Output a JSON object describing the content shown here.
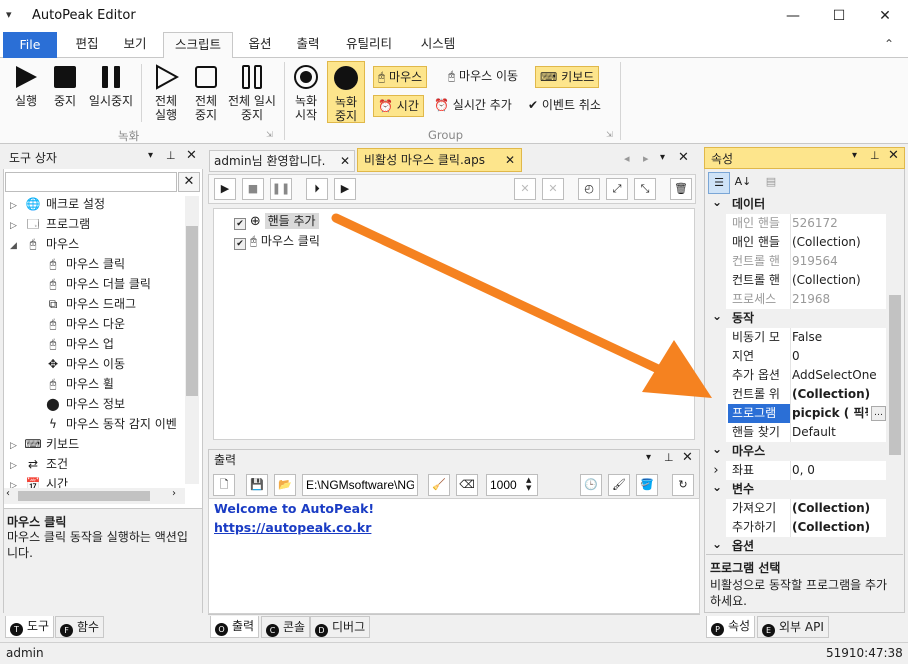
{
  "app": {
    "title": "AutoPeak Editor"
  },
  "window_controls": {
    "minimize": "—",
    "maximize": "☐",
    "close": "✕"
  },
  "ribbon_tabs": [
    "File",
    "편집",
    "보기",
    "스크립트",
    "옵션",
    "출력",
    "유틸리티",
    "시스템"
  ],
  "ribbon_active_tab": "스크립트",
  "ribbon": {
    "group1": {
      "label": "녹화",
      "buttons": [
        "실행",
        "중지",
        "일시중지",
        "전체 실행",
        "전체 중지",
        "전체 일시중지"
      ]
    },
    "group2": {
      "label": "Group",
      "record_start": "녹화 시작",
      "record_stop": "녹화 중지",
      "mouse": "마우스",
      "mouse_move": "마우스 이동",
      "keyboard": "키보드",
      "time": "시간",
      "realtime_add": "실시간 추가",
      "event_cancel": "이벤트 취소"
    }
  },
  "toolbox": {
    "title": "도구 상자",
    "search_placeholder": "",
    "items": [
      {
        "label": "매크로 설정",
        "level": 0,
        "expander": "▷",
        "icon": "globe-icon"
      },
      {
        "label": "프로그램",
        "level": 0,
        "expander": "▷",
        "icon": "window-icon"
      },
      {
        "label": "마우스",
        "level": 0,
        "expander": "◢",
        "icon": "mouse-icon"
      },
      {
        "label": "마우스 클릭",
        "level": 1,
        "icon": "mouse-click-icon"
      },
      {
        "label": "마우스 더블 클릭",
        "level": 1,
        "icon": "mouse-double-click-icon"
      },
      {
        "label": "마우스 드래그",
        "level": 1,
        "icon": "mouse-drag-icon"
      },
      {
        "label": "마우스 다운",
        "level": 1,
        "icon": "mouse-down-icon"
      },
      {
        "label": "마우스 업",
        "level": 1,
        "icon": "mouse-up-icon"
      },
      {
        "label": "마우스 이동",
        "level": 1,
        "icon": "move-icon"
      },
      {
        "label": "마우스 휠",
        "level": 1,
        "icon": "mouse-wheel-icon"
      },
      {
        "label": "마우스 정보",
        "level": 1,
        "icon": "mouse-info-icon"
      },
      {
        "label": "마우스 동작 감지 이벤",
        "level": 1,
        "icon": "lightning-icon"
      },
      {
        "label": "키보드",
        "level": 0,
        "expander": "▷",
        "icon": "keyboard-icon"
      },
      {
        "label": "조건",
        "level": 0,
        "expander": "▷",
        "icon": "condition-icon"
      },
      {
        "label": "시간",
        "level": 0,
        "expander": "▷",
        "icon": "calendar-icon"
      }
    ],
    "description_title": "마우스 클릭",
    "description_text": "마우스 클릭 동작을 실행하는 액션입니다.",
    "tabs": [
      {
        "key": "T",
        "label": "도구"
      },
      {
        "key": "F",
        "label": "함수"
      }
    ]
  },
  "editor": {
    "tabs": [
      {
        "label": "admin님 환영합니다.",
        "active": false
      },
      {
        "label": "비활성 마우스 클릭.aps",
        "active": true
      }
    ],
    "script_items": [
      {
        "label": "핸들 추가",
        "checked": true,
        "selected": true
      },
      {
        "label": "마우스 클릭",
        "checked": true,
        "selected": false
      }
    ]
  },
  "output": {
    "title": "출력",
    "path_value": "E:\\NGMsoftware\\NG",
    "interval_value": "1000",
    "lines": [
      {
        "text": "Welcome to AutoPeak!",
        "type": "bold"
      },
      {
        "text": "https://autopeak.co.kr",
        "type": "link"
      }
    ],
    "tabs": [
      {
        "key": "O",
        "label": "출력"
      },
      {
        "key": "C",
        "label": "콘솔"
      },
      {
        "key": "D",
        "label": "디버그"
      }
    ]
  },
  "properties": {
    "title": "속성",
    "rows": [
      {
        "type": "cat",
        "label": "데이터"
      },
      {
        "key": "매인 핸들",
        "value": "526172",
        "greyed": true
      },
      {
        "key": "매인 핸들",
        "value": "(Collection)"
      },
      {
        "key": "컨트롤 핸",
        "value": "919564",
        "greyed": true
      },
      {
        "key": "컨트롤 핸",
        "value": "(Collection)"
      },
      {
        "key": "프로세스",
        "value": "21968",
        "greyed": true
      },
      {
        "type": "cat",
        "label": "동작"
      },
      {
        "key": "비동기 모",
        "value": "False"
      },
      {
        "key": "지연",
        "value": "0"
      },
      {
        "key": "추가 옵션",
        "value": "AddSelectOne"
      },
      {
        "key": "컨트롤 위",
        "value": "(Collection)",
        "bold": true
      },
      {
        "key": "프로그램",
        "value": "picpick ( 픽픽",
        "bold": true,
        "selected": true
      },
      {
        "key": "핸들 찾기",
        "value": "Default"
      },
      {
        "type": "cat",
        "label": "마우스"
      },
      {
        "key": "좌표",
        "value": "0, 0",
        "expander": true
      },
      {
        "type": "cat",
        "label": "변수"
      },
      {
        "key": "가져오기",
        "value": "(Collection)",
        "bold": true
      },
      {
        "key": "추가하기",
        "value": "(Collection)",
        "bold": true
      },
      {
        "type": "cat",
        "label": "옵션"
      }
    ],
    "description_title": "프로그램 선택",
    "description_text": "비활성으로 동작할 프로그램을 추가하세요.",
    "tabs": [
      {
        "key": "P",
        "label": "속성"
      },
      {
        "key": "E",
        "label": "외부 API"
      }
    ]
  },
  "status": {
    "user": "admin",
    "time": "51910:47:38"
  },
  "colors": {
    "accent": "#2b6fd6",
    "highlight": "#fde58c",
    "arrow": "#f58220",
    "link": "#1a3cc4"
  }
}
